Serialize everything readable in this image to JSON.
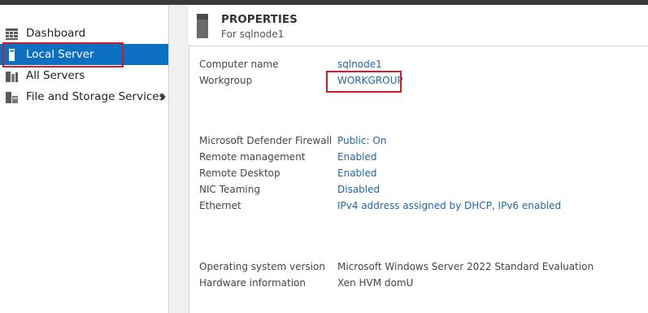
{
  "sidebar": {
    "items": [
      {
        "label": "Dashboard",
        "icon": "dashboard-icon"
      },
      {
        "label": "Local Server",
        "icon": "server-icon",
        "active": true
      },
      {
        "label": "All Servers",
        "icon": "servers-icon"
      },
      {
        "label": "File and Storage Services",
        "icon": "file-storage-icon",
        "has_submenu": true
      }
    ]
  },
  "properties": {
    "title": "PROPERTIES",
    "subtitle": "For sqlnode1",
    "groups": [
      [
        {
          "key": "Computer name",
          "value": "sqlnode1",
          "link": true
        },
        {
          "key": "Workgroup",
          "value": "WORKGROUP",
          "link": true
        }
      ],
      [
        {
          "key": "Microsoft Defender Firewall",
          "value": "Public: On",
          "link": true
        },
        {
          "key": "Remote management",
          "value": "Enabled",
          "link": true
        },
        {
          "key": "Remote Desktop",
          "value": "Enabled",
          "link": true
        },
        {
          "key": "NIC Teaming",
          "value": "Disabled",
          "link": true
        },
        {
          "key": "Ethernet",
          "value": "IPv4 address assigned by DHCP, IPv6 enabled",
          "link": true
        }
      ],
      [
        {
          "key": "Operating system version",
          "value": "Microsoft Windows Server 2022 Standard Evaluation",
          "link": false
        },
        {
          "key": "Hardware information",
          "value": "Xen HVM domU",
          "link": false
        }
      ]
    ]
  },
  "colors": {
    "accent": "#0d6fc0",
    "link": "#1f67a8",
    "highlight": "#d31c2a"
  }
}
